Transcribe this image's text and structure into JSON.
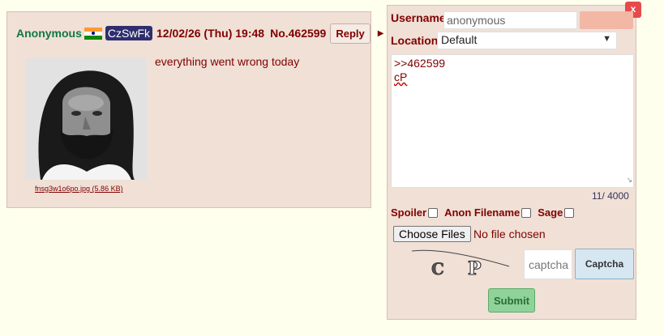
{
  "post": {
    "name": "Anonymous",
    "flag_icon": "india-flag-icon",
    "poster_id": "CzSwFk",
    "date": "12/02/26 (Thu) 19:48",
    "number": "No.462599",
    "reply_label": "Reply",
    "menu_icon": "▶",
    "file_name": "fnsg3w1o6po.jpg (5.86 KB)",
    "message": "everything went wrong today"
  },
  "form": {
    "close_label": "x",
    "username_label": "Username",
    "username_value": "anonymous",
    "location_label": "Location",
    "location_value": "Default",
    "message_line1": ">>462599",
    "message_line2": "cP",
    "counter": "11/ 4000",
    "spoiler_label": "Spoiler",
    "anon_filename_label": "Anon Filename",
    "sage_label": "Sage",
    "choose_files_label": "Choose Files",
    "no_file_text": "No file chosen",
    "captcha_placeholder": "captcha",
    "captcha_button": "Captcha",
    "submit_label": "Submit"
  },
  "colors": {
    "post_bg": "#f0e0d6",
    "page_bg": "#ffffee",
    "name_green": "#117743",
    "text_maroon": "#800000",
    "close_red": "#e64b4b",
    "submit_green": "#8fd29a"
  }
}
